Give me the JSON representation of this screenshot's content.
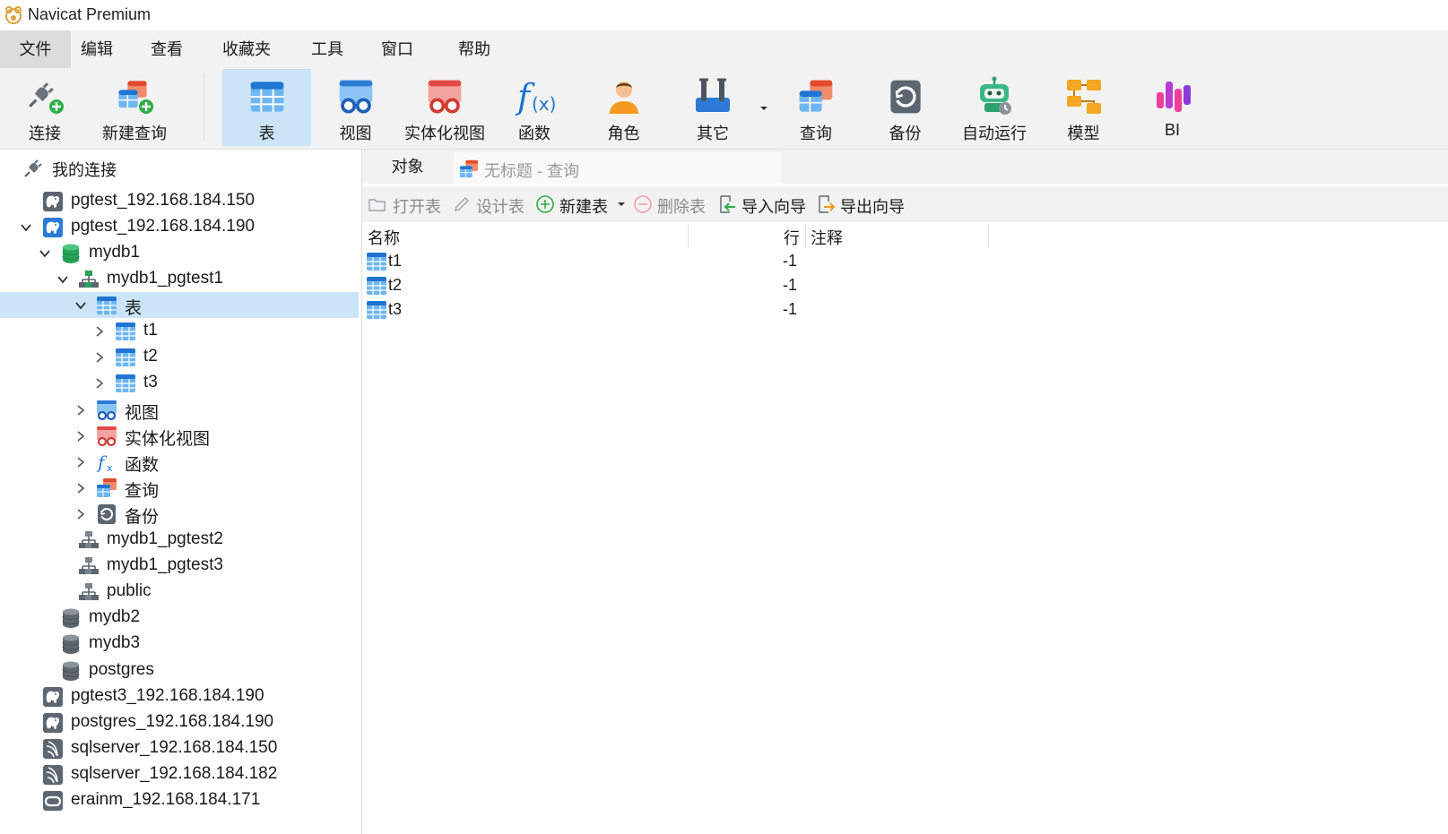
{
  "window": {
    "title": "Navicat Premium"
  },
  "menu": [
    "文件",
    "编辑",
    "查看",
    "收藏夹",
    "工具",
    "窗口",
    "帮助"
  ],
  "toolbar": {
    "items": [
      {
        "label": "连接",
        "icon": "plug-connect-icon"
      },
      {
        "label": "新建查询",
        "icon": "new-query-icon"
      },
      {
        "label": "表",
        "icon": "table-icon",
        "active": true
      },
      {
        "label": "视图",
        "icon": "view-icon"
      },
      {
        "label": "实体化视图",
        "icon": "materialized-view-icon"
      },
      {
        "label": "函数",
        "icon": "function-icon"
      },
      {
        "label": "角色",
        "icon": "role-user-icon"
      },
      {
        "label": "其它",
        "icon": "tools-icon"
      },
      {
        "label": "查询",
        "icon": "query-icon"
      },
      {
        "label": "备份",
        "icon": "backup-icon"
      },
      {
        "label": "自动运行",
        "icon": "robot-automation-icon"
      },
      {
        "label": "模型",
        "icon": "model-icon"
      },
      {
        "label": "BI",
        "icon": "bi-chart-icon"
      }
    ]
  },
  "sidebar": {
    "root": "我的连接",
    "nodes": [
      {
        "label": "pgtest_192.168.184.150",
        "type": "postgres-connection"
      },
      {
        "label": "pgtest_192.168.184.190",
        "type": "postgres-connection",
        "expanded": true
      },
      {
        "label": "mydb1",
        "type": "database-open",
        "expanded": true
      },
      {
        "label": "mydb1_pgtest1",
        "type": "schema-open",
        "expanded": true
      },
      {
        "label": "表",
        "type": "tables-folder",
        "expanded": true,
        "selected": true
      },
      {
        "label": "t1",
        "type": "table"
      },
      {
        "label": "t2",
        "type": "table"
      },
      {
        "label": "t3",
        "type": "table"
      },
      {
        "label": "视图",
        "type": "views-folder"
      },
      {
        "label": "实体化视图",
        "type": "materialized-views-folder"
      },
      {
        "label": "函数",
        "type": "functions-folder"
      },
      {
        "label": "查询",
        "type": "queries-folder"
      },
      {
        "label": "备份",
        "type": "backups-folder"
      },
      {
        "label": "mydb1_pgtest2",
        "type": "schema"
      },
      {
        "label": "mydb1_pgtest3",
        "type": "schema"
      },
      {
        "label": "public",
        "type": "schema"
      },
      {
        "label": "mydb2",
        "type": "database"
      },
      {
        "label": "mydb3",
        "type": "database"
      },
      {
        "label": "postgres",
        "type": "database"
      },
      {
        "label": "pgtest3_192.168.184.190",
        "type": "postgres-connection"
      },
      {
        "label": "postgres_192.168.184.190",
        "type": "postgres-connection"
      },
      {
        "label": "sqlserver_192.168.184.150",
        "type": "sqlserver-connection"
      },
      {
        "label": "sqlserver_192.168.184.182",
        "type": "sqlserver-connection"
      },
      {
        "label": "erainm_192.168.184.171",
        "type": "oracle-connection"
      }
    ]
  },
  "tabs": {
    "objects": "对象",
    "query": "无标题 - 查询"
  },
  "object_toolbar": {
    "open_table": "打开表",
    "design_table": "设计表",
    "new_table": "新建表",
    "delete_table": "删除表",
    "import_wizard": "导入向导",
    "export_wizard": "导出向导"
  },
  "object_table": {
    "columns": {
      "name": "名称",
      "rows": "行",
      "comment": "注释"
    },
    "rows": [
      {
        "name": "t1",
        "rows": "-1",
        "comment": ""
      },
      {
        "name": "t2",
        "rows": "-1",
        "comment": ""
      },
      {
        "name": "t3",
        "rows": "-1",
        "comment": ""
      }
    ]
  },
  "colors": {
    "selection": "#cce4f7",
    "menu_bg": "#f2f2f2",
    "table_blue": "#2b7bd6",
    "db_green": "#27a35a"
  }
}
